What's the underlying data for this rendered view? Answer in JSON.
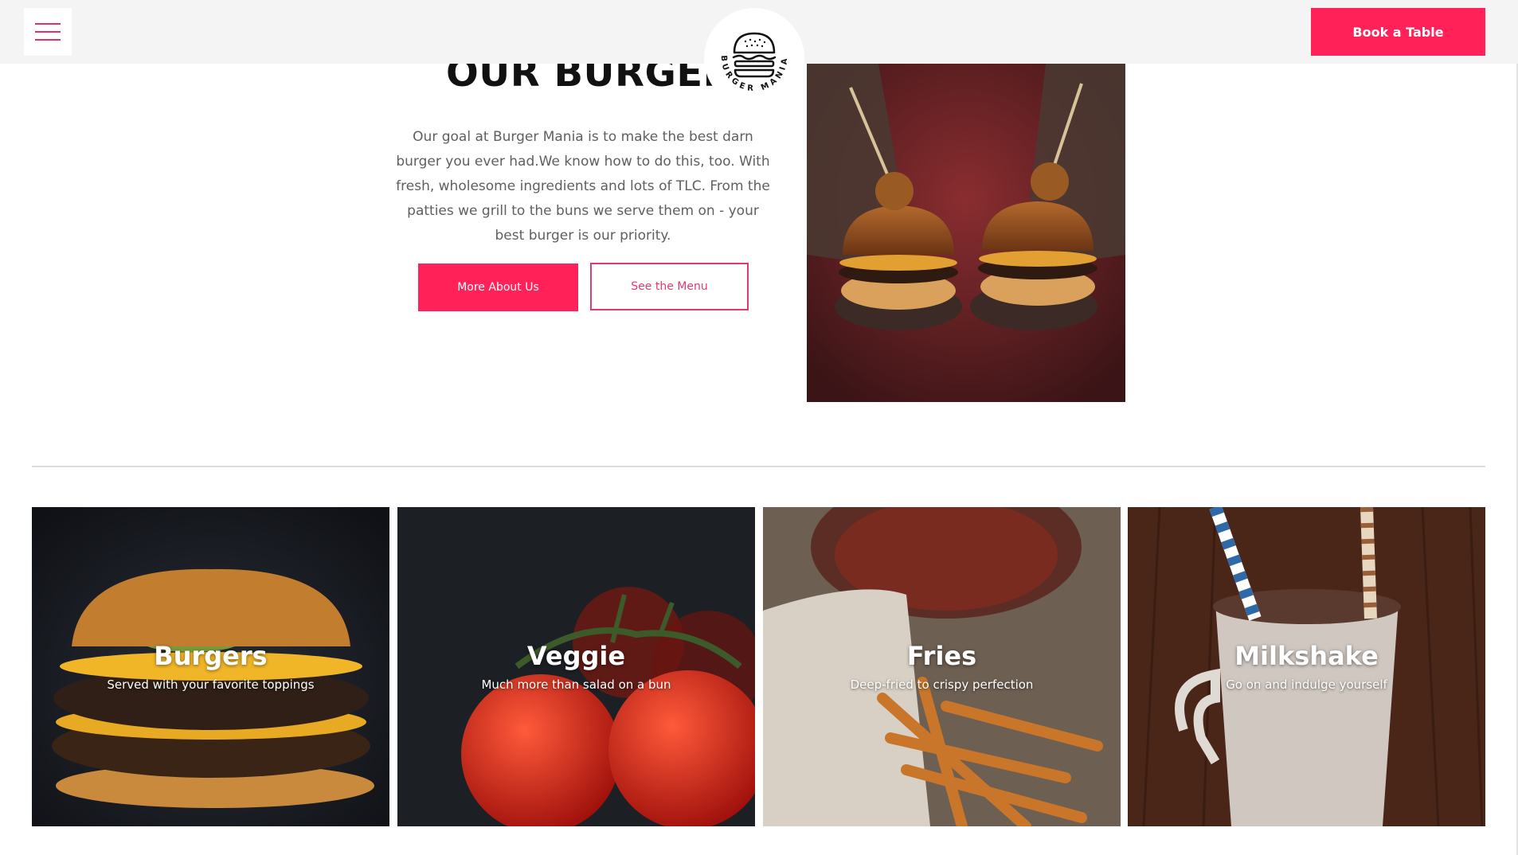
{
  "header": {
    "menu_icon": "hamburger-menu-icon",
    "logo_text": "BURGER MANIA",
    "book_button": "Book a Table"
  },
  "intro": {
    "title": "OUR BURGER",
    "paragraph": "Our goal at Burger Mania is to make the best darn burger you ever had.We know how to do this, too. With fresh, wholesome ingredients and lots of TLC. From the patties we grill to the buns we serve them on - your best burger is our priority.",
    "primary_button": "More About Us",
    "secondary_button": "See the Menu",
    "photo": "two-burgers-in-hands-photo"
  },
  "categories": [
    {
      "title": "Burgers",
      "subtitle": "Served with your favorite toppings",
      "image": "burger-photo"
    },
    {
      "title": "Veggie",
      "subtitle": "Much more than salad on a bun",
      "image": "tomatoes-photo"
    },
    {
      "title": "Fries",
      "subtitle": "Deep-fried to crispy perfection",
      "image": "fries-photo"
    },
    {
      "title": "Milkshake",
      "subtitle": "Go on and indulge yourself",
      "image": "milkshake-photo"
    }
  ],
  "colors": {
    "accent": "#ff2158",
    "header_bg": "#f4f4f4",
    "text": "#5f5f5f"
  }
}
